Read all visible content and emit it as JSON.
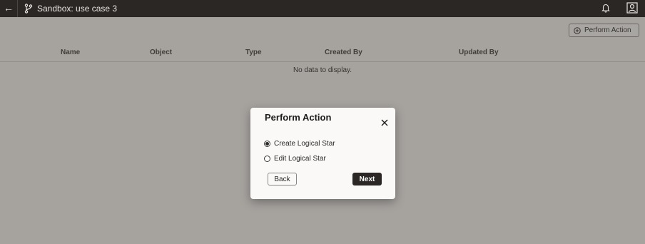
{
  "header": {
    "title": "Sandbox: use case 3",
    "back_icon": "arrow-left-icon",
    "branch_icon": "branch-icon",
    "notifications_icon": "bell-icon",
    "user_icon": "user-icon"
  },
  "toolbar": {
    "perform_action_label": "Perform Action",
    "perform_action_icon": "plus-circle-icon"
  },
  "table": {
    "columns": [
      "Name",
      "Object",
      "Type",
      "Created By",
      "Updated By"
    ],
    "empty_text": "No data to display."
  },
  "dialog": {
    "title": "Perform Action",
    "options": [
      {
        "label": "Create Logical Star",
        "selected": true
      },
      {
        "label": "Edit Logical Star",
        "selected": false
      }
    ],
    "back_label": "Back",
    "next_label": "Next"
  },
  "colors": {
    "header_bg": "#2a2725",
    "overlay": "rgba(70,66,62,0.45)",
    "primary_button": "#2a2725"
  }
}
